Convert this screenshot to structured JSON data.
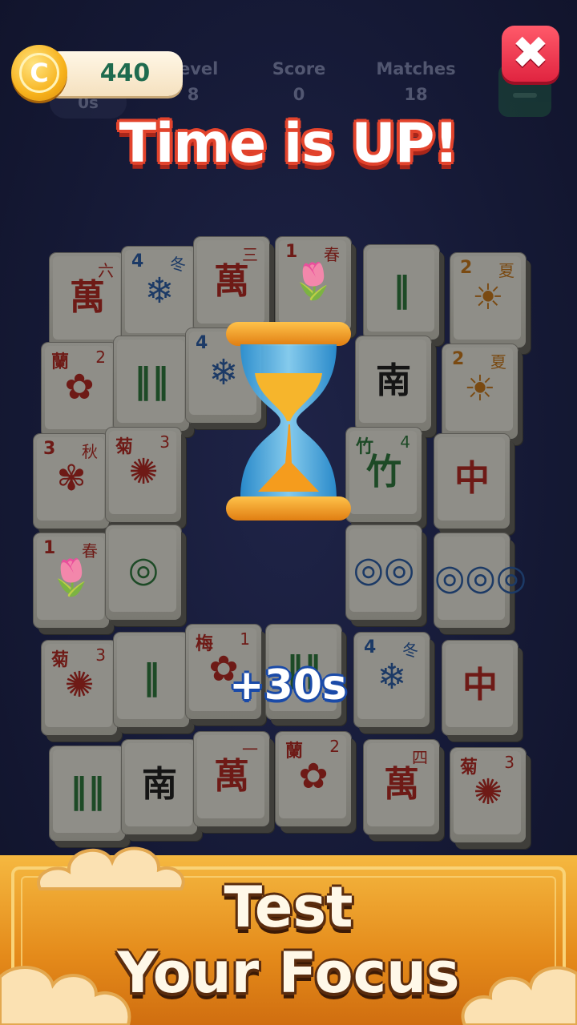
{
  "hud": {
    "timer": "0s",
    "stats": [
      {
        "label": "Level",
        "value": "8"
      },
      {
        "label": "Score",
        "value": "0"
      },
      {
        "label": "Matches",
        "value": "18"
      }
    ]
  },
  "coins": "440",
  "close_label": "✖",
  "title": "Time is UP!",
  "bonus": "+30s",
  "tagline_line1": "Test",
  "tagline_line2": "Your Focus",
  "tiles": [
    {
      "glyph": "萬",
      "num": "",
      "han": "六",
      "color": "red"
    },
    {
      "glyph": "❄",
      "num": "4",
      "han": "冬",
      "color": "blue"
    },
    {
      "glyph": "萬",
      "num": "",
      "han": "三",
      "color": "red"
    },
    {
      "glyph": "🌷",
      "num": "1",
      "han": "春",
      "color": "red"
    },
    {
      "glyph": "‖",
      "num": "",
      "han": "",
      "color": "green"
    },
    {
      "glyph": "☀",
      "num": "2",
      "han": "夏",
      "color": "orange"
    },
    {
      "glyph": "✿",
      "num": "蘭",
      "han": "2",
      "color": "red"
    },
    {
      "glyph": "‖‖",
      "num": "",
      "han": "",
      "color": "green"
    },
    {
      "glyph": "❄",
      "num": "4",
      "han": "",
      "color": "blue"
    },
    {
      "glyph": "南",
      "num": "",
      "han": "",
      "color": "black"
    },
    {
      "glyph": "☀",
      "num": "2",
      "han": "夏",
      "color": "orange"
    },
    {
      "glyph": "✾",
      "num": "3",
      "han": "秋",
      "color": "red"
    },
    {
      "glyph": "✺",
      "num": "菊",
      "han": "3",
      "color": "red"
    },
    {
      "glyph": "竹",
      "num": "竹",
      "han": "4",
      "color": "green"
    },
    {
      "glyph": "中",
      "num": "",
      "han": "",
      "color": "red"
    },
    {
      "glyph": "🌷",
      "num": "1",
      "han": "春",
      "color": "red"
    },
    {
      "glyph": "◎",
      "num": "",
      "han": "",
      "color": "green"
    },
    {
      "glyph": "◎◎",
      "num": "",
      "han": "",
      "color": "blue"
    },
    {
      "glyph": "◎◎◎",
      "num": "",
      "han": "",
      "color": "blue"
    },
    {
      "glyph": "✺",
      "num": "菊",
      "han": "3",
      "color": "red"
    },
    {
      "glyph": "‖",
      "num": "",
      "han": "",
      "color": "green"
    },
    {
      "glyph": "✿",
      "num": "梅",
      "han": "1",
      "color": "red"
    },
    {
      "glyph": "‖‖",
      "num": "",
      "han": "",
      "color": "green"
    },
    {
      "glyph": "❄",
      "num": "4",
      "han": "冬",
      "color": "blue"
    },
    {
      "glyph": "中",
      "num": "",
      "han": "",
      "color": "red"
    },
    {
      "glyph": "‖‖",
      "num": "",
      "han": "",
      "color": "green"
    },
    {
      "glyph": "南",
      "num": "",
      "han": "",
      "color": "black"
    },
    {
      "glyph": "萬",
      "num": "",
      "han": "一",
      "color": "red"
    },
    {
      "glyph": "✿",
      "num": "蘭",
      "han": "2",
      "color": "red"
    },
    {
      "glyph": "萬",
      "num": "",
      "han": "四",
      "color": "red"
    },
    {
      "glyph": "✺",
      "num": "菊",
      "han": "3",
      "color": "red"
    }
  ]
}
